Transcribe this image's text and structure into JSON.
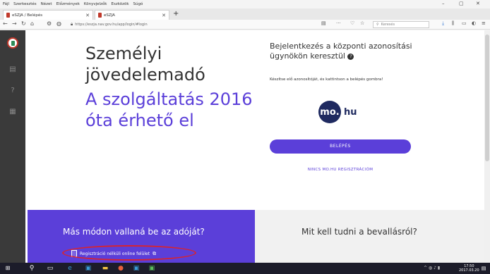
{
  "browser": {
    "menu": [
      "Fájl",
      "Szerkesztés",
      "Nézet",
      "Előzmények",
      "Könyvjelzők",
      "Eszközök",
      "Súgó"
    ],
    "tabs": [
      {
        "label": "eSZJA / Belépés"
      },
      {
        "label": "eSZJA"
      }
    ],
    "url": "https://eszja.nav.gov.hu/app/login/#login",
    "search_placeholder": "Keresés"
  },
  "page": {
    "title_lines": [
      "Személyi",
      "jövedelemadó",
      "A szolgáltatás 2016",
      "óta érhető el"
    ],
    "login": {
      "title": "Bejelentkezés a központi azonosítási ügynökön keresztül",
      "info_icon": "?",
      "description": "Készítse elő azonosítóját, és kattintson a belépés gombra!",
      "logo_circle": "mo.",
      "logo_text": "hu",
      "button_label": "BELÉPÉS",
      "no_registration_link": "NINCS MO.HU REGISZTRÁCIÓM"
    },
    "other_way": {
      "title": "Más módon vallaná be az adóját?",
      "link_label": "Regisztráció nélküli online felület"
    },
    "info_panel": {
      "title": "Mit kell tudni a bevallásról?"
    }
  },
  "taskbar": {
    "clock_time": "17:50",
    "clock_date": "2017.03.20"
  },
  "colors": {
    "accent_purple": "#5b3fd9",
    "highlight_red": "#d9232d",
    "mohu_navy": "#1f2a60"
  }
}
